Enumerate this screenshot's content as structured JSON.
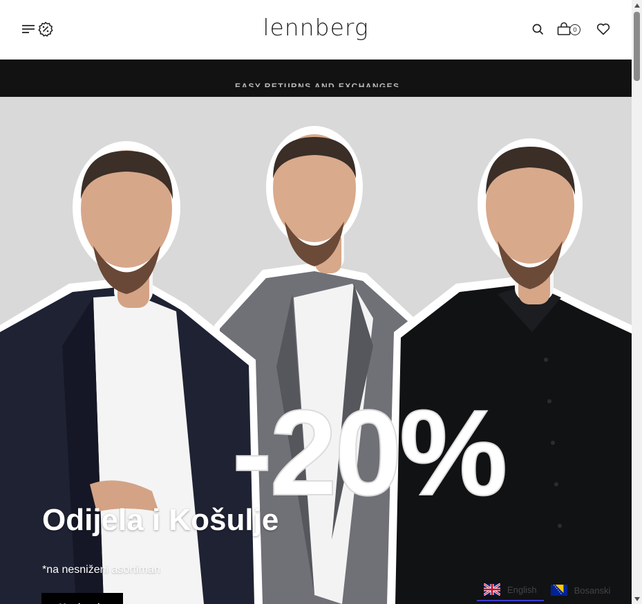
{
  "header": {
    "logo": "lennberg",
    "cart_count": "0"
  },
  "announcement": {
    "text": "EASY RETURNS AND EXCHANGES"
  },
  "hero": {
    "discount": "-20%",
    "title": "Odijela i Košulje",
    "subtitle": "*na nesniženi asortiman",
    "cta": "Kupi sada"
  },
  "languages": [
    {
      "label": "English",
      "icon": "uk-flag-icon",
      "active": true
    },
    {
      "label": "Bosanski",
      "icon": "bosnia-flag-icon",
      "active": false
    }
  ],
  "colors": {
    "announcement_bg": "#121212",
    "hero_bg": "#d9d9d9",
    "cta_bg": "#000000",
    "lang_active": "#3b3bd6"
  }
}
